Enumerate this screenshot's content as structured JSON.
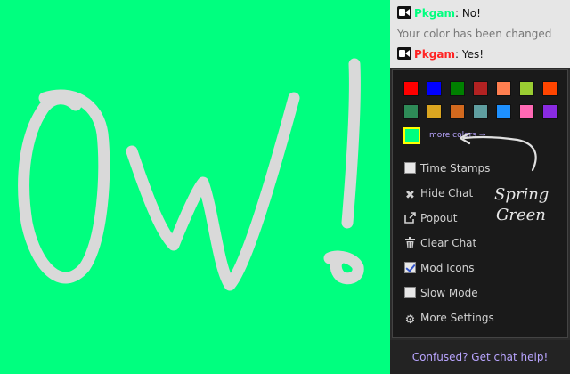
{
  "chat": {
    "messages": [
      {
        "user": "Pkgam",
        "user_color": "#00ff7f",
        "text": "No!"
      },
      {
        "system": "Your color has been changed"
      },
      {
        "user": "Pkgam",
        "user_color": "#ff2222",
        "text": "Yes!"
      }
    ],
    "separator": ": "
  },
  "settings": {
    "swatches": [
      "#ff0000",
      "#0000ff",
      "#008000",
      "#b22222",
      "#ff7f50",
      "#9acd32",
      "#ff4500",
      "#2e8b57",
      "#daa520",
      "#d2691e",
      "#5f9ea0",
      "#1e90ff",
      "#ff69b4",
      "#8a2be2",
      "#00ff7f"
    ],
    "selected_color": "#00ff7f",
    "more_colors_label": "more colors →",
    "options": [
      {
        "key": "time-stamps",
        "label": "Time Stamps",
        "kind": "checkbox",
        "checked": false
      },
      {
        "key": "hide-chat",
        "label": "Hide Chat",
        "kind": "icon",
        "icon": "close-icon"
      },
      {
        "key": "popout",
        "label": "Popout",
        "kind": "icon",
        "icon": "external-link-icon"
      },
      {
        "key": "clear-chat",
        "label": "Clear Chat",
        "kind": "icon",
        "icon": "trash-icon"
      },
      {
        "key": "mod-icons",
        "label": "Mod Icons",
        "kind": "checkbox",
        "checked": true
      },
      {
        "key": "slow-mode",
        "label": "Slow Mode",
        "kind": "checkbox",
        "checked": false
      },
      {
        "key": "more-settings",
        "label": "More Settings",
        "kind": "icon",
        "icon": "gear-icon"
      }
    ],
    "help_text": "Confused? Get chat help!"
  },
  "annotation": {
    "line1": "Spring",
    "line2": "Green"
  },
  "canvas": {
    "text": "Ow!"
  },
  "colors": {
    "canvas_bg": "#00ff7f",
    "scribble": "#d9d9d9",
    "link": "#b9a5ff"
  }
}
